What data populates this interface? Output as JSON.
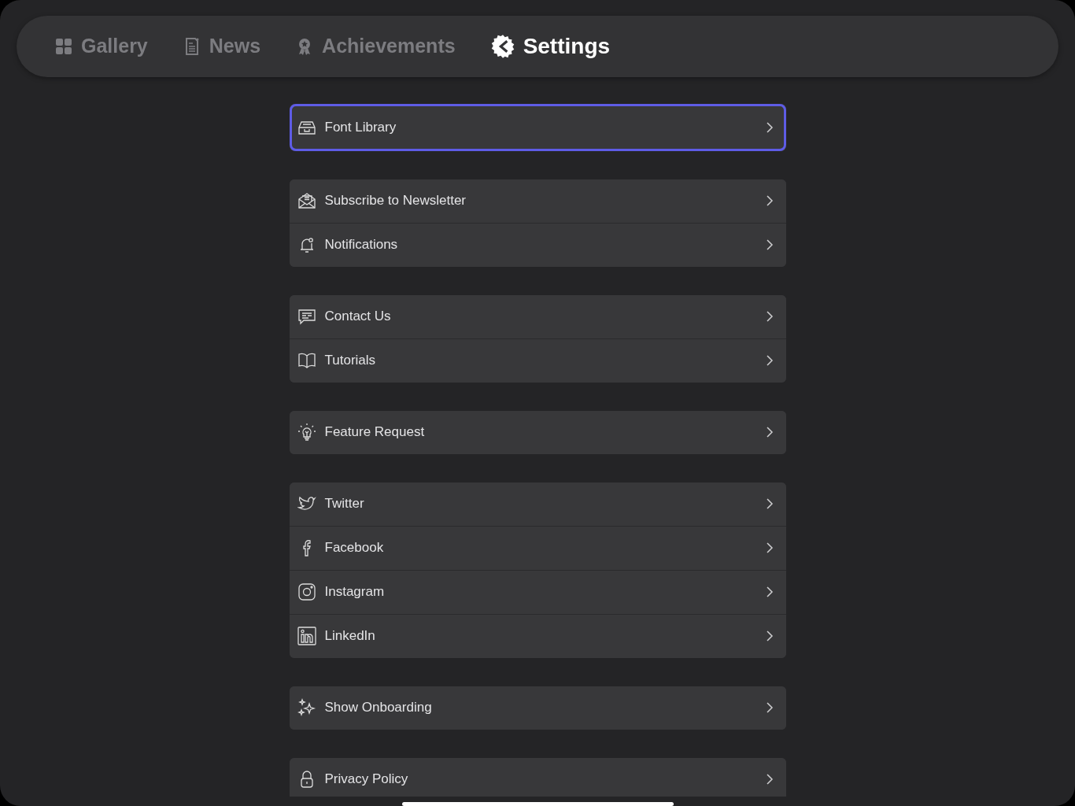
{
  "tabs": [
    {
      "label": "Gallery",
      "selected": false
    },
    {
      "label": "News",
      "selected": false
    },
    {
      "label": "Achievements",
      "selected": false
    },
    {
      "label": "Settings",
      "selected": true
    }
  ],
  "settings_groups": [
    {
      "items": [
        {
          "label": "Font Library",
          "focused": true
        }
      ]
    },
    {
      "items": [
        {
          "label": "Subscribe to Newsletter",
          "focused": false
        },
        {
          "label": "Notifications",
          "focused": false
        }
      ]
    },
    {
      "items": [
        {
          "label": "Contact Us",
          "focused": false
        },
        {
          "label": "Tutorials",
          "focused": false
        }
      ]
    },
    {
      "items": [
        {
          "label": "Feature Request",
          "focused": false
        }
      ]
    },
    {
      "items": [
        {
          "label": "Twitter",
          "focused": false
        },
        {
          "label": "Facebook",
          "focused": false
        },
        {
          "label": "Instagram",
          "focused": false
        },
        {
          "label": "LinkedIn",
          "focused": false
        }
      ]
    },
    {
      "items": [
        {
          "label": "Show Onboarding",
          "focused": false
        }
      ]
    },
    {
      "items": [
        {
          "label": "Privacy Policy",
          "focused": false
        }
      ]
    }
  ]
}
